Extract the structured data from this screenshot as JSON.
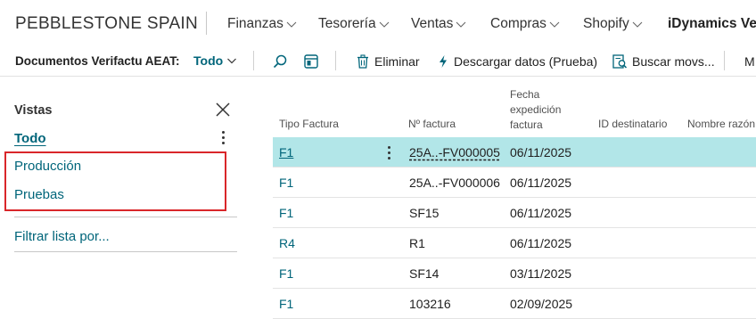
{
  "topnav": {
    "company": "PEBBLESTONE SPAIN",
    "items": [
      {
        "label": "Finanzas",
        "has_chevron": true
      },
      {
        "label": "Tesorería",
        "has_chevron": true
      },
      {
        "label": "Ventas",
        "has_chevron": true
      },
      {
        "label": "Compras",
        "has_chevron": true
      },
      {
        "label": "Shopify",
        "has_chevron": true
      },
      {
        "label": "iDynamics Veri",
        "has_chevron": false
      }
    ]
  },
  "actionbar": {
    "title": "Documentos Verifactu AEAT:",
    "view_selected": "Todo",
    "search_icon": "search-icon",
    "filter_pane_icon": "filter-pane-icon",
    "delete_label": "Eliminar",
    "delete_icon": "trash-icon",
    "download_label": "Descargar datos (Prueba)",
    "download_icon": "lightning-icon",
    "find_entries_label": "Buscar movs...",
    "find_entries_icon": "find-entries-icon",
    "more_label": "M"
  },
  "views": {
    "title": "Vistas",
    "all": "Todo",
    "items": [
      "Producción",
      "Pruebas"
    ],
    "filter_link": "Filtrar lista por...",
    "highlight_color": "#d9262a"
  },
  "grid": {
    "columns": [
      {
        "label": "Tipo Factura"
      },
      {
        "label": "Nº factura"
      },
      {
        "label_lines": [
          "Fecha",
          "expedición",
          "factura"
        ]
      },
      {
        "label": "ID destinatario"
      },
      {
        "label": "Nombre razón"
      }
    ],
    "rows": [
      {
        "tipo": "F1",
        "numero": "25A..-FV000005",
        "fecha": "06/11/2025",
        "selected": true
      },
      {
        "tipo": "F1",
        "numero": "25A..-FV000006",
        "fecha": "06/11/2025",
        "selected": false
      },
      {
        "tipo": "F1",
        "numero": "SF15",
        "fecha": "06/11/2025",
        "selected": false
      },
      {
        "tipo": "R4",
        "numero": "R1",
        "fecha": "06/11/2025",
        "selected": false
      },
      {
        "tipo": "F1",
        "numero": "SF14",
        "fecha": "03/11/2025",
        "selected": false
      },
      {
        "tipo": "F1",
        "numero": "103216",
        "fecha": "02/09/2025",
        "selected": false
      }
    ],
    "selected_color": "#b2e6e8",
    "accent_color": "#00657a"
  }
}
